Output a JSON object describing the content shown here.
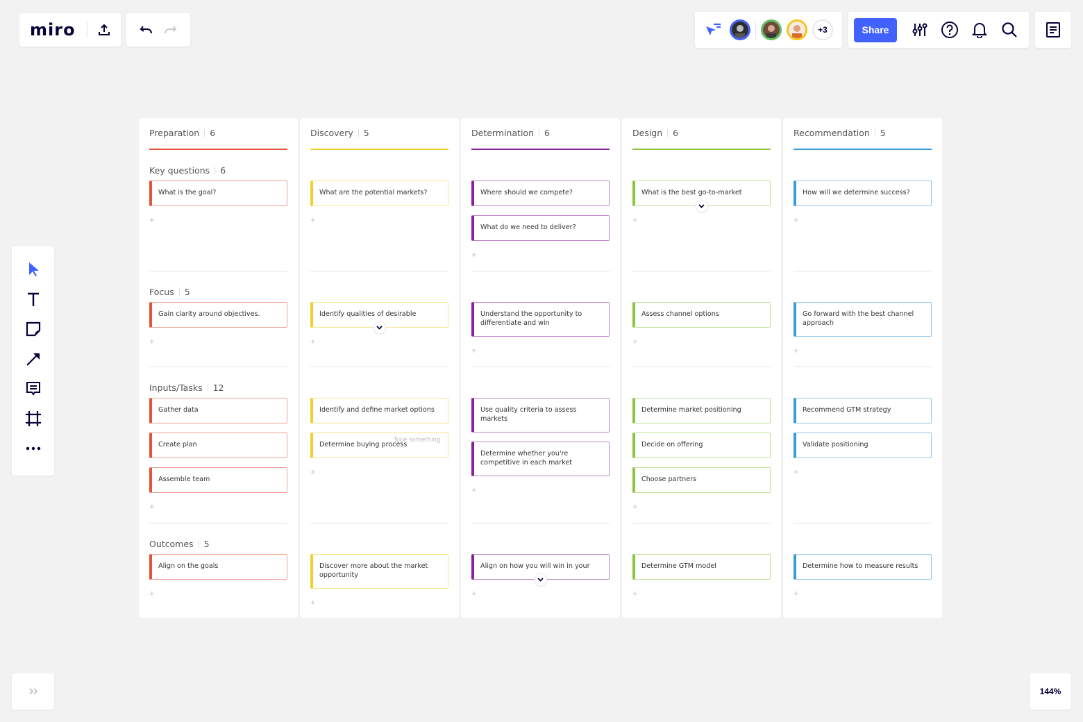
{
  "app": {
    "logo": "miro"
  },
  "header": {
    "share_label": "Share",
    "collaborators": [
      {
        "name": "collaborator-1",
        "ring_color": "#4262ff"
      },
      {
        "name": "collaborator-2",
        "ring_color": "#5fc05f"
      },
      {
        "name": "collaborator-3",
        "ring_color": "#f5c518"
      }
    ],
    "more_collaborators": "+3",
    "icons": [
      "follow-cursor-icon",
      "settings-sliders-icon",
      "help-icon",
      "bell-icon",
      "search-icon",
      "notes-icon"
    ]
  },
  "toolbar": {
    "tools": [
      "select-tool",
      "text-tool",
      "sticky-note-tool",
      "arrow-tool",
      "comment-tool",
      "frame-tool",
      "more-tool"
    ]
  },
  "zoom_level": "144%",
  "board": {
    "columns": [
      {
        "title": "Preparation",
        "count": "6",
        "color": "#e2553a"
      },
      {
        "title": "Discovery",
        "count": "5",
        "color": "#f2d02b"
      },
      {
        "title": "Determination",
        "count": "6",
        "color": "#8c1f9e"
      },
      {
        "title": "Design",
        "count": "6",
        "color": "#8cc63f"
      },
      {
        "title": "Recommendation",
        "count": "5",
        "color": "#3b9bd9"
      }
    ],
    "sections": [
      {
        "title": "Key questions",
        "count": "6"
      },
      {
        "title": "Focus",
        "count": "5"
      },
      {
        "title": "Inputs/Tasks",
        "count": "12"
      },
      {
        "title": "Outcomes",
        "count": "5"
      }
    ],
    "cards": {
      "c0s0": [
        "What is the goal?"
      ],
      "c1s0": [
        "What are the potential markets?"
      ],
      "c2s0": [
        "Where should we compete?",
        "What do we need to deliver?"
      ],
      "c3s0": [
        "What is the best go-to-market"
      ],
      "c4s0": [
        "How will we determine success?"
      ],
      "c0s1": [
        "Gain clarity around objectives."
      ],
      "c1s1": [
        "Identify qualities of desirable"
      ],
      "c2s1": [
        "Understand the opportunity to differentiate and win"
      ],
      "c3s1": [
        "Assess channel options"
      ],
      "c4s1": [
        "Go forward with the best channel approach"
      ],
      "c0s2": [
        "Gather data",
        "Create plan",
        "Assemble team"
      ],
      "c1s2": [
        "Identify and define market options",
        "Determine buying process"
      ],
      "c2s2": [
        "Use quality criteria to assess markets",
        "Determine whether you're competitive in each market"
      ],
      "c3s2": [
        "Determine market positioning",
        "Decide on offering",
        "Choose partners"
      ],
      "c4s2": [
        "Recommend GTM strategy",
        "Validate positioning"
      ],
      "c0s3": [
        "Align on the goals"
      ],
      "c1s3": [
        "Discover more about the market opportunity"
      ],
      "c2s3": [
        "Align on how you will win in your"
      ],
      "c3s3": [
        "Determine GTM model"
      ],
      "c4s3": [
        "Determine how to measure results"
      ]
    },
    "typing_hint": "Type something",
    "add_symbol": "+"
  }
}
